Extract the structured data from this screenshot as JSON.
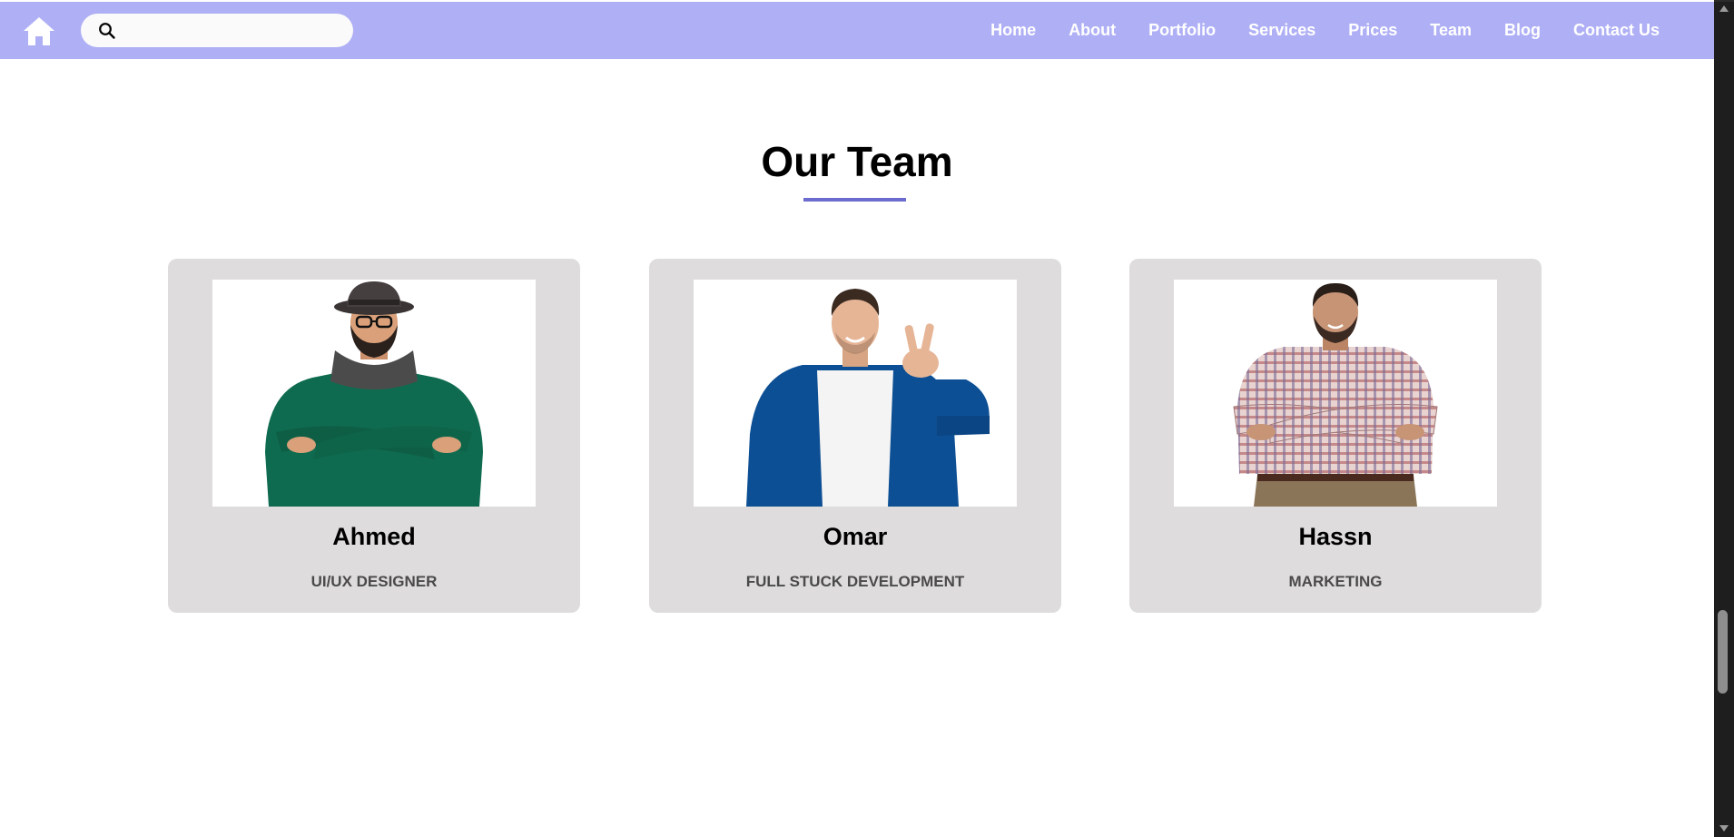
{
  "nav": {
    "home_icon": "home-icon",
    "search_icon": "search-icon",
    "search_value": "",
    "links": [
      "Home",
      "About",
      "Portfolio",
      "Services",
      "Prices",
      "Team",
      "Blog",
      "Contact Us"
    ],
    "background_color": "#afaff6"
  },
  "team": {
    "title": "Our Team",
    "accent_color": "#6c6cd0",
    "members": [
      {
        "name": "Ahmed",
        "role": "UI/UX DESIGNER",
        "photo": "man-green-sweater-hat-photo"
      },
      {
        "name": "Omar",
        "role": "FULL STUCK DEVELOPMENT",
        "photo": "man-blue-jacket-peace-sign-photo"
      },
      {
        "name": "Hassn",
        "role": "MARKETING",
        "photo": "man-plaid-shirt-arms-crossed-photo"
      }
    ]
  }
}
